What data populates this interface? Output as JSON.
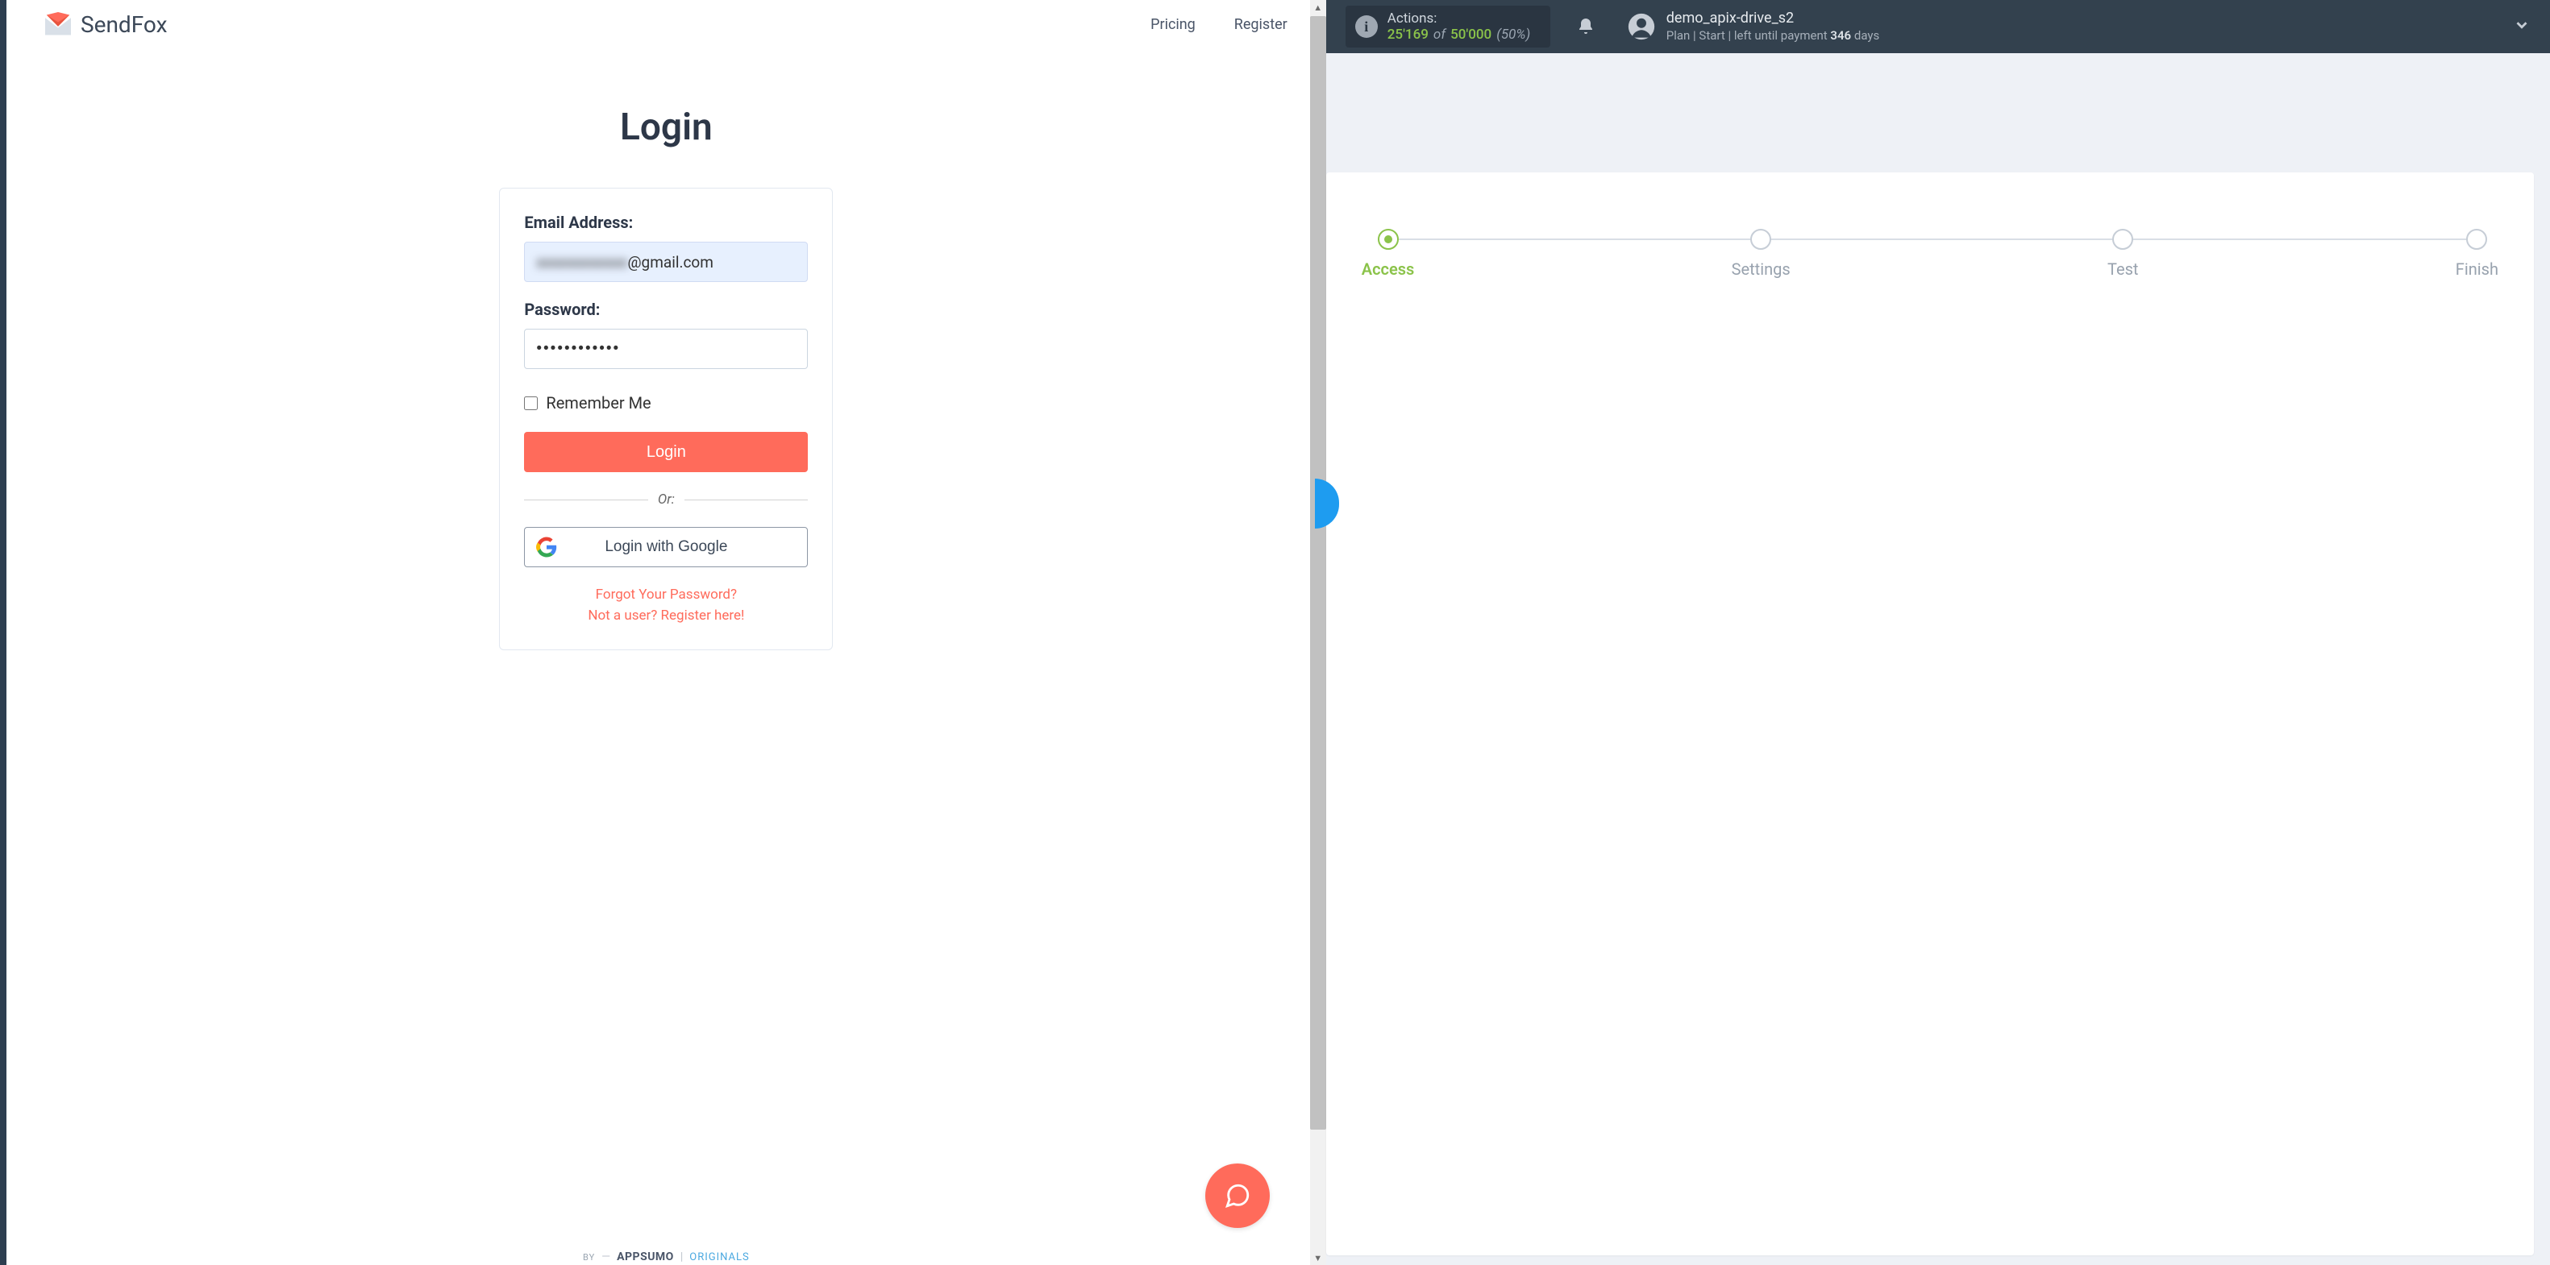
{
  "sendfox": {
    "brand": "SendFox",
    "nav": {
      "pricing": "Pricing",
      "register": "Register"
    },
    "title": "Login",
    "email_label": "Email Address:",
    "email_value_blurred": "xxxxxxxxxxxx",
    "email_value_clear": "@gmail.com",
    "password_label": "Password:",
    "password_value": "••••••••••••",
    "remember_label": "Remember Me",
    "login_btn": "Login",
    "or": "Or:",
    "google_btn": "Login with Google",
    "forgot": "Forgot Your Password?",
    "register_here": "Not a user? Register here!",
    "footer_by": "BY",
    "footer_brand": "APPSUMO",
    "footer_sub": "ORIGINALS"
  },
  "apix": {
    "actions_label": "Actions:",
    "actions_used": "25'169",
    "actions_of": "of",
    "actions_total": "50'000",
    "actions_pct": "(50%)",
    "username": "demo_apix-drive_s2",
    "plan_prefix": "Plan |",
    "plan_name": "Start",
    "plan_mid": "| left until payment",
    "plan_days_num": "346",
    "plan_days_word": "days",
    "steps": [
      {
        "label": "Access",
        "active": true
      },
      {
        "label": "Settings",
        "active": false
      },
      {
        "label": "Test",
        "active": false
      },
      {
        "label": "Finish",
        "active": false
      }
    ]
  }
}
